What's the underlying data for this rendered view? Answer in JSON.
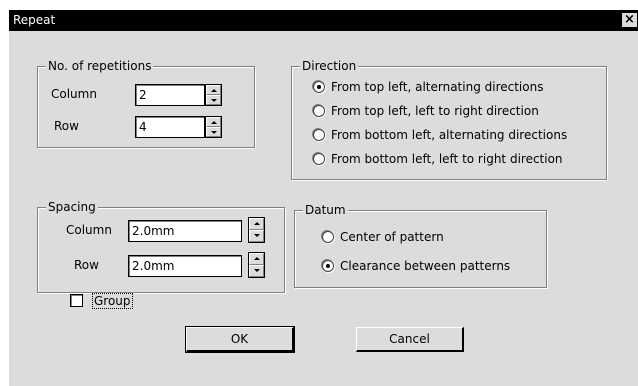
{
  "window": {
    "title": "Repeat",
    "close_glyph": "×"
  },
  "repetitions": {
    "legend": "No. of repetitions",
    "column_label": "Column",
    "column_value": "2",
    "row_label": "Row",
    "row_value": "4"
  },
  "direction": {
    "legend": "Direction",
    "options": [
      {
        "label": "From top left, alternating directions",
        "selected": true
      },
      {
        "label": "From top left, left to right direction",
        "selected": false
      },
      {
        "label": "From bottom left, alternating directions",
        "selected": false
      },
      {
        "label": "From bottom left, left to right direction",
        "selected": false
      }
    ]
  },
  "spacing": {
    "legend": "Spacing",
    "column_label": "Column",
    "column_value": "2.0mm",
    "row_label": "Row",
    "row_value": "2.0mm"
  },
  "datum": {
    "legend": "Datum",
    "options": [
      {
        "label": "Center of pattern",
        "selected": false
      },
      {
        "label": "Clearance between patterns",
        "selected": true
      }
    ]
  },
  "group_checkbox": {
    "label": "Group",
    "checked": false
  },
  "buttons": {
    "ok": "OK",
    "cancel": "Cancel"
  }
}
